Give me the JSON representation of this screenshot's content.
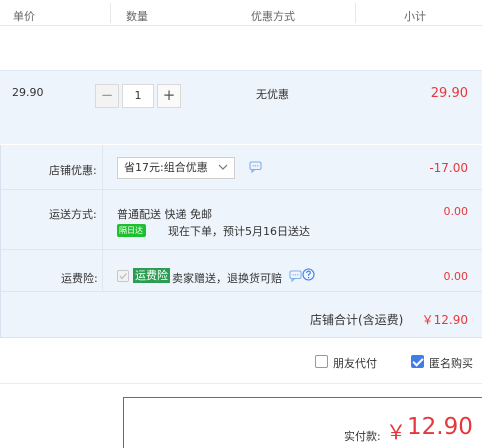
{
  "header": {
    "col_price": "单价",
    "col_qty": "数量",
    "col_discount": "优惠方式",
    "col_subtotal": "小计"
  },
  "item": {
    "price": "29.90",
    "qty_minus": "−",
    "qty_value": "1",
    "qty_plus": "+",
    "discount": "无优惠",
    "subtotal": "29.90"
  },
  "shop": {
    "discount_label": "店铺优惠:",
    "discount_select": "省17元:组合优惠",
    "discount_amount": "-17.00",
    "shipping_label": "运送方式:",
    "shipping_method": "普通配送 快递 免邮",
    "shipping_badge": "隔日达",
    "shipping_note": "现在下单，预计5月16日送达",
    "shipping_amount": "0.00",
    "insurance_label": "运费险:",
    "insurance_badge": "运费险",
    "insurance_text": "卖家赠送，退换货可赔",
    "insurance_amount": "0.00",
    "total_label": "店铺合计(含运费)",
    "total_value": "￥12.90"
  },
  "options": {
    "friend_pay_label": "朋友代付",
    "friend_pay_checked": false,
    "anonymous_label": "匿名购买",
    "anonymous_checked": true
  },
  "payment": {
    "label": "实付款:",
    "currency": "￥",
    "amount": "12.90"
  },
  "colors": {
    "accent_red": "#e4393c",
    "band_blue": "#eef4fb",
    "check_blue": "#3d7eea",
    "badge_green": "#1fc02f"
  }
}
